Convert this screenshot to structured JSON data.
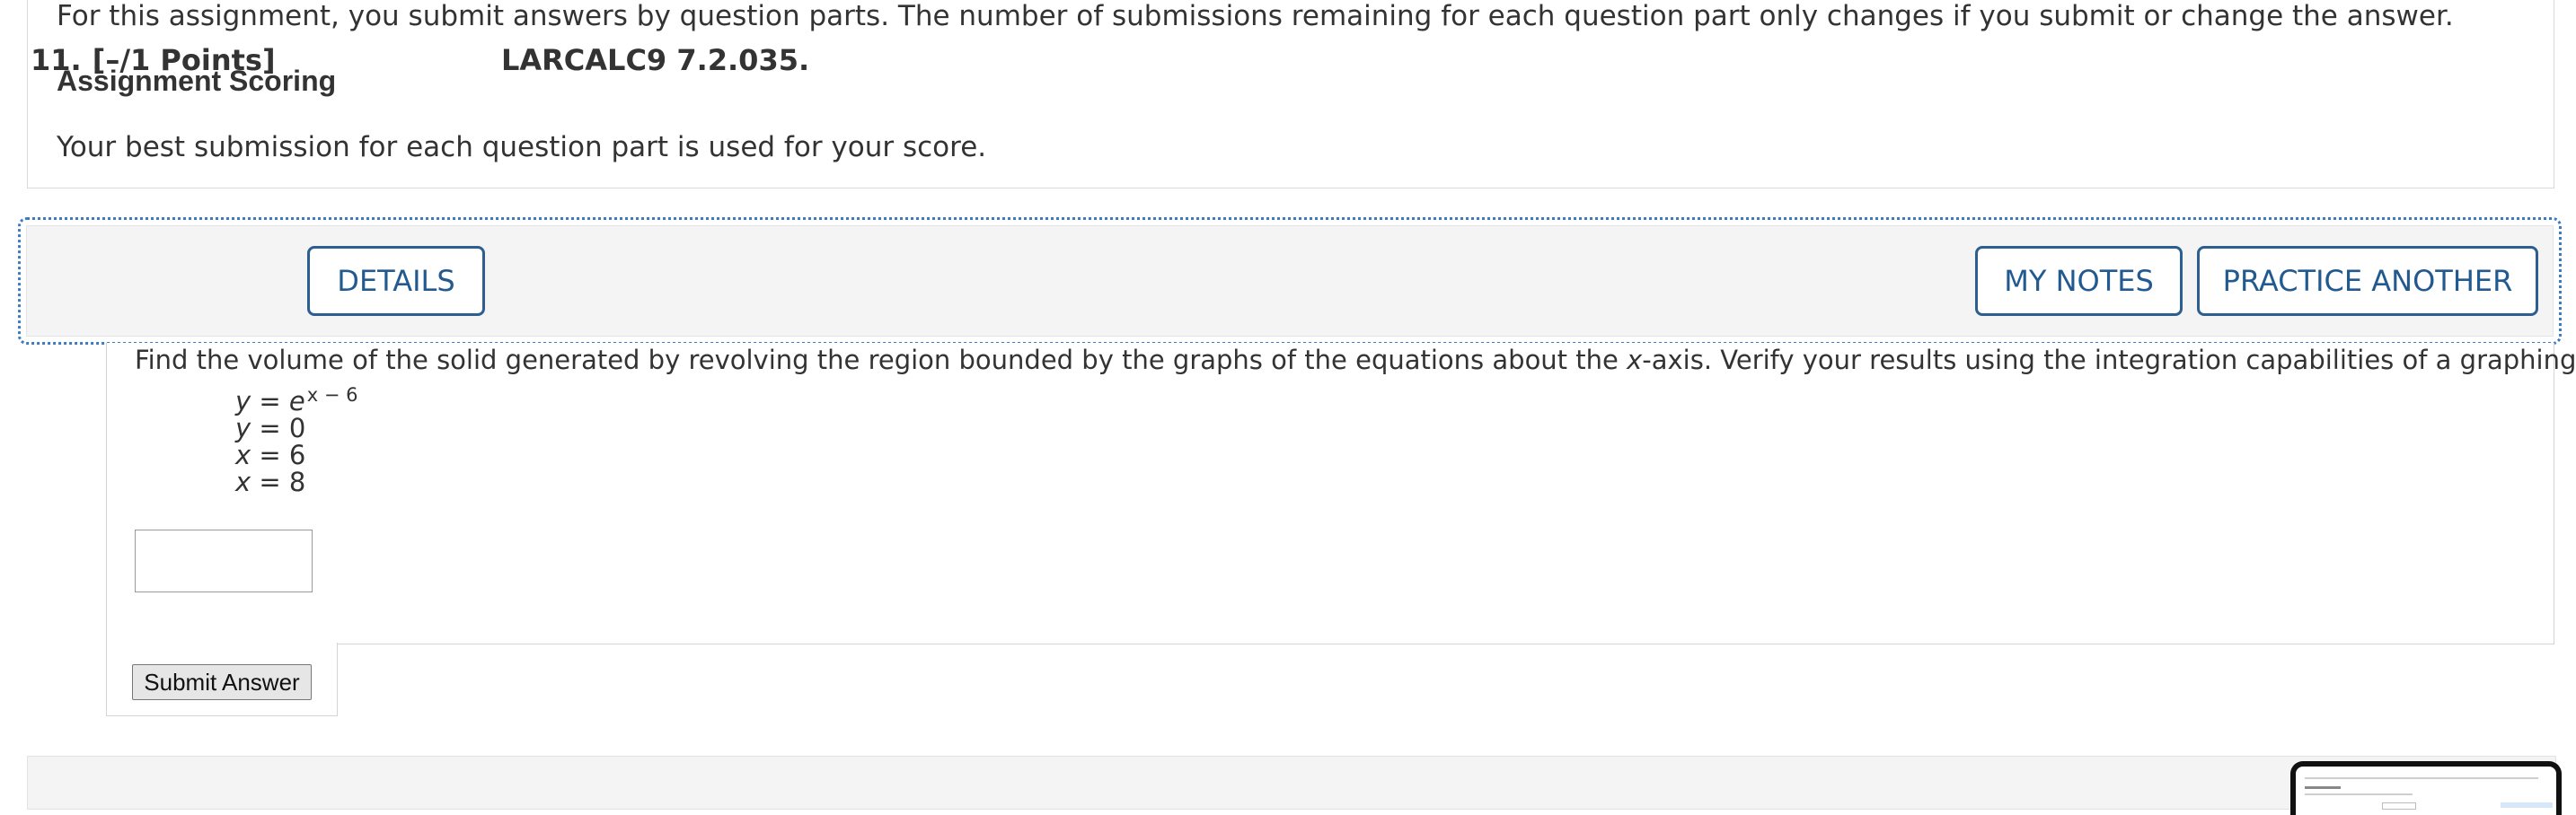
{
  "assignment_info": {
    "submission_text": "For this assignment, you submit answers by question parts. The number of submissions remaining for each question part only changes if you submit or change the answer.",
    "scoring_heading": "Assignment Scoring",
    "scoring_text": "Your best submission for each question part is used for your score."
  },
  "question": {
    "number": "11.",
    "points": "[–/1 Points]",
    "details_label": "DETAILS",
    "code": "LARCALC9 7.2.035.",
    "my_notes_label": "MY NOTES",
    "practice_label": "PRACTICE ANOTHER",
    "prompt_before": "Find the volume of the solid generated by revolving the region bounded by the graphs of the equations about the ",
    "prompt_var": "x",
    "prompt_after": "-axis. Verify your results using the integration capabilities of a graphing utility.",
    "equations": [
      {
        "lhs": "y",
        "op": " = ",
        "rhs": "e",
        "sup": "x − 6"
      },
      {
        "lhs": "y",
        "op": " = ",
        "rhs": "0",
        "sup": ""
      },
      {
        "lhs": "x",
        "op": " = ",
        "rhs": "6",
        "sup": ""
      },
      {
        "lhs": "x",
        "op": " = ",
        "rhs": "8",
        "sup": ""
      }
    ],
    "answer_value": "",
    "submit_label": "Submit Answer"
  }
}
